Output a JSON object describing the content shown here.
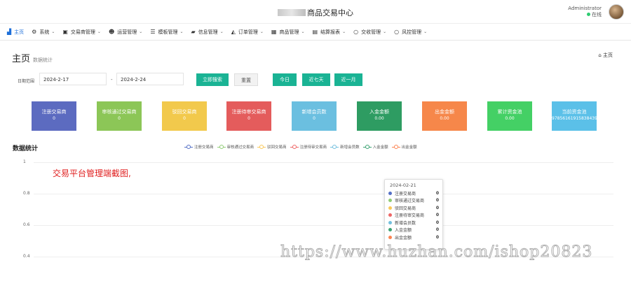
{
  "header": {
    "title": "商品交易中心",
    "admin_name": "Administrator",
    "admin_status": "在线"
  },
  "nav": {
    "items": [
      {
        "label": "主页",
        "icon": "bar-chart-icon",
        "caret": false,
        "active": true
      },
      {
        "label": "系统",
        "icon": "gear-icon",
        "caret": true
      },
      {
        "label": "交易商管理",
        "icon": "building-icon",
        "caret": true
      },
      {
        "label": "运营管理",
        "icon": "user-icon",
        "caret": true
      },
      {
        "label": "模板管理",
        "icon": "list-icon",
        "caret": true
      },
      {
        "label": "信息管理",
        "icon": "book-icon",
        "caret": true
      },
      {
        "label": "订单管理",
        "icon": "area-chart-icon",
        "caret": true
      },
      {
        "label": "商品管理",
        "icon": "calendar-icon",
        "caret": true
      },
      {
        "label": "结算报表",
        "icon": "table-icon",
        "caret": true
      },
      {
        "label": "交收管理",
        "icon": "circle-icon",
        "caret": true
      },
      {
        "label": "风控管理",
        "icon": "circle-icon",
        "caret": true
      }
    ]
  },
  "page": {
    "title": "主页",
    "subtitle": "数据统计",
    "breadcrumb": "主页"
  },
  "filter": {
    "label": "日期范围",
    "start_date": "2024-2-17",
    "end_date": "2024-2-24",
    "dash": "-",
    "search_label": "立即搜索",
    "reset_label": "重置",
    "today_label": "今日",
    "week_label": "近七天",
    "month_label": "近一月"
  },
  "cards": [
    {
      "label": "注册交易商",
      "value": "0",
      "color": "#5c6bc0"
    },
    {
      "label": "审核通过交易商",
      "value": "0",
      "color": "#8cc657"
    },
    {
      "label": "驳回交易商",
      "value": "0",
      "color": "#f2c94c"
    },
    {
      "label": "注册待审交易商",
      "value": "0",
      "color": "#e45c5c"
    },
    {
      "label": "新增会员数",
      "value": "0",
      "color": "#6bbfe0"
    },
    {
      "label": "入金金额",
      "value": "0.00",
      "color": "#2e9c62"
    },
    {
      "label": "出金金额",
      "value": "0.00",
      "color": "#f6874a"
    },
    {
      "label": "累计资金池",
      "value": "0.00",
      "color": "#44d065"
    },
    {
      "label": "当前资金池",
      "value": "97856161915838439",
      "color": "#5bc0e8"
    }
  ],
  "stats": {
    "title": "数据统计",
    "note": "交易平台管理端截图,"
  },
  "chart_data": {
    "type": "line",
    "x": [
      "2024-02-21"
    ],
    "ylim": [
      0,
      1
    ],
    "yticks": [
      "1",
      "0.8",
      "0.6",
      "0.4"
    ],
    "legend_position": "top",
    "series": [
      {
        "name": "注册交易商",
        "values": [
          0
        ],
        "color": "#5470c6"
      },
      {
        "name": "审核通过交易商",
        "values": [
          0
        ],
        "color": "#91cc75"
      },
      {
        "name": "驳回交易商",
        "values": [
          0
        ],
        "color": "#fac858"
      },
      {
        "name": "注册待审交易商",
        "values": [
          0
        ],
        "color": "#ee6666"
      },
      {
        "name": "新增会员数",
        "values": [
          0
        ],
        "color": "#73c0de"
      },
      {
        "name": "入金金额",
        "values": [
          0
        ],
        "color": "#3ba272"
      },
      {
        "name": "出金金额",
        "values": [
          0
        ],
        "color": "#fc8452"
      }
    ]
  },
  "tooltip": {
    "date": "2024-02-21"
  },
  "watermark": "https://www.huzhan.com/ishop20823"
}
